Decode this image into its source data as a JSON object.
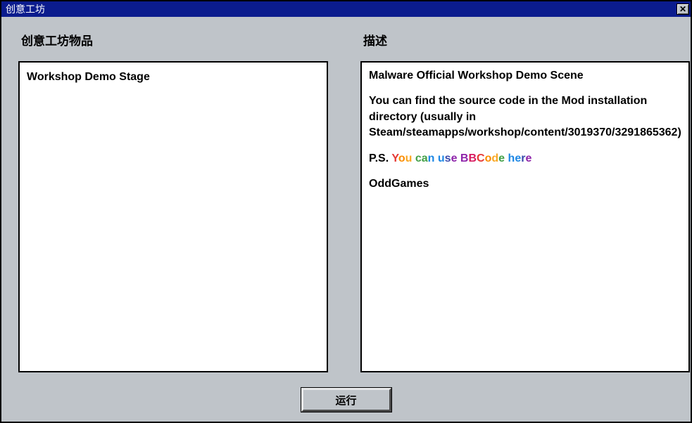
{
  "window": {
    "title": "创意工坊",
    "close_symbol": "✕"
  },
  "left": {
    "heading": "创意工坊物品",
    "items": [
      "Workshop Demo Stage"
    ]
  },
  "right": {
    "heading": "描述",
    "line1": "Malware Official Workshop Demo Scene",
    "line2": "You can find the source code in the Mod installation directory (usually in Steam/steamapps/workshop/content/3019370/3291865362)",
    "ps_prefix": "P.S. ",
    "rainbow_text": "You can use BBCode here",
    "rainbow_colors": [
      "#e53935",
      "#fb8c00",
      "#f9a825",
      "#43a047",
      "#43a047",
      "#1e88e5",
      "#1e88e5",
      "#3949ab",
      "#8e24aa",
      "#8e24aa",
      "#d81b60",
      "#e53935",
      "#fb8c00",
      "#f9a825",
      "#43a047",
      "#1e88e5",
      "#1e88e5",
      "#3949ab",
      "#8e24aa",
      "#d81b60",
      "#e53935",
      "#fb8c00",
      "#43a047"
    ],
    "author": "OddGames"
  },
  "buttons": {
    "run": "运行"
  }
}
